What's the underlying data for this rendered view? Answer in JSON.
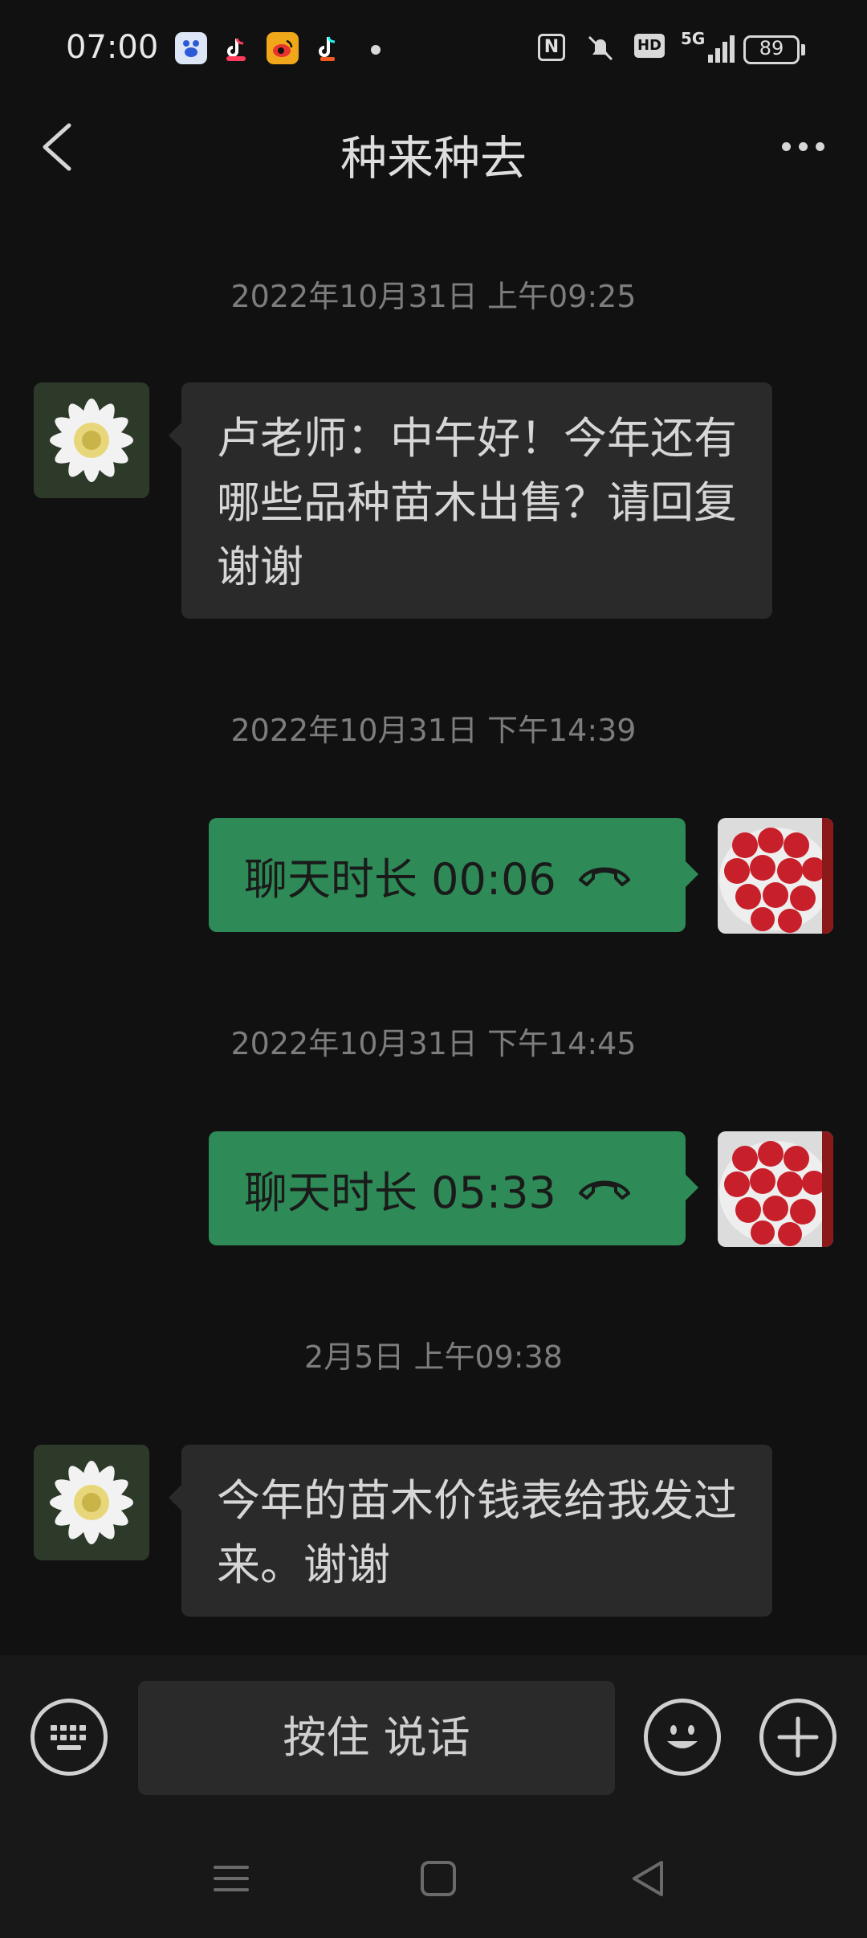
{
  "status_bar": {
    "time": "07:00",
    "network": "5G",
    "hd": "HD",
    "nfc": "N",
    "battery": "89",
    "apps": [
      "baidu-icon",
      "tiktok-lite-icon",
      "weibo-icon",
      "tiktok-icon"
    ]
  },
  "header": {
    "title": "种来种去"
  },
  "messages": [
    {
      "type": "timestamp",
      "text": "2022年10月31日 上午09:25"
    },
    {
      "type": "incoming",
      "text": "卢老师：中午好！今年还有哪些品种苗木出售？请回复谢谢"
    },
    {
      "type": "timestamp",
      "text": "2022年10月31日 下午14:39"
    },
    {
      "type": "call",
      "text": "聊天时长 00:06"
    },
    {
      "type": "timestamp",
      "text": "2022年10月31日 下午14:45"
    },
    {
      "type": "call",
      "text": "聊天时长 05:33"
    },
    {
      "type": "timestamp",
      "text": "2月5日 上午09:38"
    },
    {
      "type": "incoming",
      "text": "今年的苗木价钱表给我发过来。谢谢"
    }
  ],
  "input_bar": {
    "hold_to_talk": "按住 说话"
  },
  "colors": {
    "background": "#111111",
    "outgoing_bubble": "#2e8b57",
    "incoming_bubble": "#2a2a2a"
  }
}
